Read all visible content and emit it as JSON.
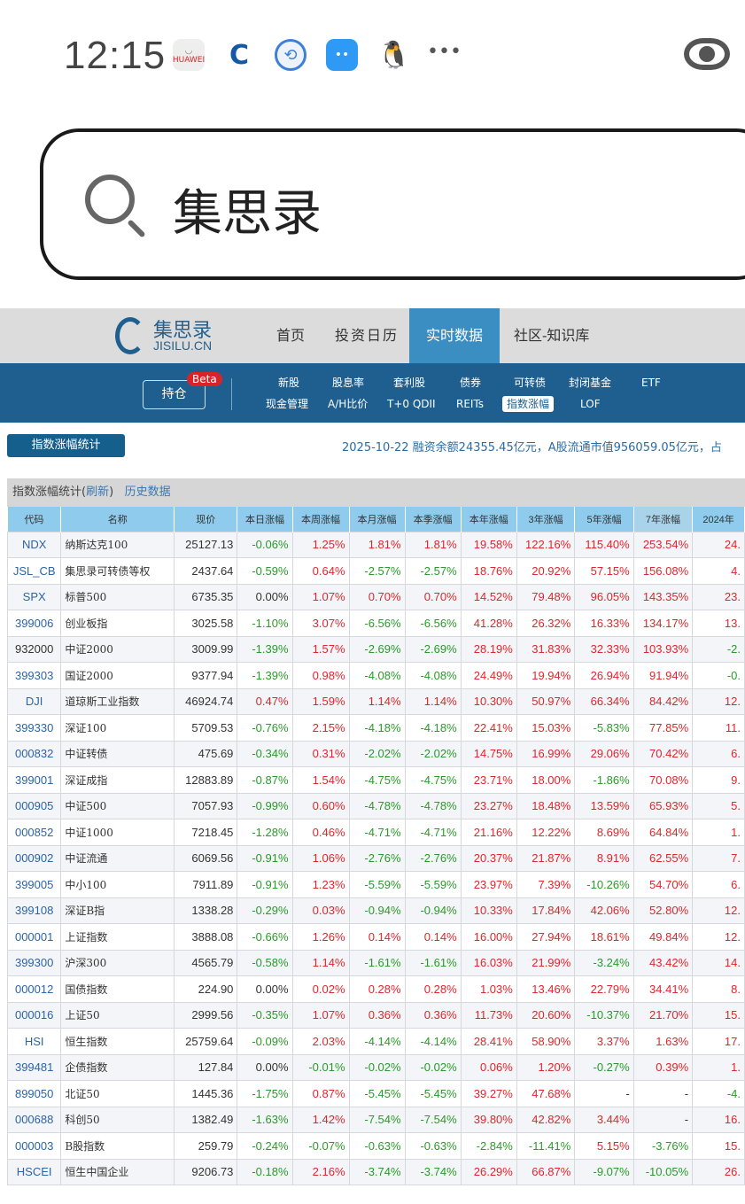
{
  "status": {
    "time": "12:15",
    "icons": [
      "huawei-appgallery-icon",
      "ccb-bank-icon",
      "app-icon",
      "message-icon",
      "qq-penguin-icon",
      "more-dots-icon",
      "eye-icon"
    ],
    "huawei": "HUAWEI",
    "more": "•••"
  },
  "search": {
    "query": "集思录"
  },
  "site": {
    "logo_cn": "集思录",
    "logo_en": "JISILU.CN",
    "nav": [
      "首页",
      "投资日历",
      "实时数据",
      "社区-知识库"
    ],
    "nav_active": 2,
    "hold": "持仓",
    "beta": "Beta",
    "sub_row1": [
      "新股",
      "股息率",
      "套利股",
      "债券",
      "可转债",
      "封闭基金",
      "ETF"
    ],
    "sub_row2": [
      "现金管理",
      "A/H比价",
      "T+0 QDII",
      "REITs",
      "指数涨幅",
      "LOF"
    ]
  },
  "page": {
    "button": "指数涨幅统计",
    "ticker": "2025-10-22 融资余额24355.45亿元，A股流通市值956059.05亿元，占",
    "title": "指数涨幅统计(",
    "refresh": "刷新",
    "title_end": ")",
    "history": "历史数据"
  },
  "colors": {
    "up": "#e0262b",
    "down": "#2a9a2a",
    "header": "#8ecbec",
    "band": "#1f5f8f"
  },
  "table": {
    "headers": [
      "代码",
      "名称",
      "现价",
      "本日涨幅",
      "本周涨幅",
      "本月涨幅",
      "本季涨幅",
      "本年涨幅",
      "3年涨幅",
      "5年涨幅",
      "7年涨幅",
      "2024年"
    ],
    "rows": [
      [
        "NDX",
        "纳斯达克100",
        "25127.13",
        "-0.06%",
        "1.25%",
        "1.81%",
        "1.81%",
        "19.58%",
        "122.16%",
        "115.40%",
        "253.54%",
        "24."
      ],
      [
        "JSL_CB",
        "集思录可转债等权",
        "2437.64",
        "-0.59%",
        "0.64%",
        "-2.57%",
        "-2.57%",
        "18.76%",
        "20.92%",
        "57.15%",
        "156.08%",
        "4."
      ],
      [
        "SPX",
        "标普500",
        "6735.35",
        "0.00%",
        "1.07%",
        "0.70%",
        "0.70%",
        "14.52%",
        "79.48%",
        "96.05%",
        "143.35%",
        "23."
      ],
      [
        "399006",
        "创业板指",
        "3025.58",
        "-1.10%",
        "3.07%",
        "-6.56%",
        "-6.56%",
        "41.28%",
        "26.32%",
        "16.33%",
        "134.17%",
        "13."
      ],
      [
        "932000",
        "中证2000",
        "3009.99",
        "-1.39%",
        "1.57%",
        "-2.69%",
        "-2.69%",
        "28.19%",
        "31.83%",
        "32.33%",
        "103.93%",
        "-2."
      ],
      [
        "399303",
        "国证2000",
        "9377.94",
        "-1.39%",
        "0.98%",
        "-4.08%",
        "-4.08%",
        "24.49%",
        "19.94%",
        "26.94%",
        "91.94%",
        "-0."
      ],
      [
        "DJI",
        "道琼斯工业指数",
        "46924.74",
        "0.47%",
        "1.59%",
        "1.14%",
        "1.14%",
        "10.30%",
        "50.97%",
        "66.34%",
        "84.42%",
        "12."
      ],
      [
        "399330",
        "深证100",
        "5709.53",
        "-0.76%",
        "2.15%",
        "-4.18%",
        "-4.18%",
        "22.41%",
        "15.03%",
        "-5.83%",
        "77.85%",
        "11."
      ],
      [
        "000832",
        "中证转债",
        "475.69",
        "-0.34%",
        "0.31%",
        "-2.02%",
        "-2.02%",
        "14.75%",
        "16.99%",
        "29.06%",
        "70.42%",
        "6."
      ],
      [
        "399001",
        "深证成指",
        "12883.89",
        "-0.87%",
        "1.54%",
        "-4.75%",
        "-4.75%",
        "23.71%",
        "18.00%",
        "-1.86%",
        "70.08%",
        "9."
      ],
      [
        "000905",
        "中证500",
        "7057.93",
        "-0.99%",
        "0.60%",
        "-4.78%",
        "-4.78%",
        "23.27%",
        "18.48%",
        "13.59%",
        "65.93%",
        "5."
      ],
      [
        "000852",
        "中证1000",
        "7218.45",
        "-1.28%",
        "0.46%",
        "-4.71%",
        "-4.71%",
        "21.16%",
        "12.22%",
        "8.69%",
        "64.84%",
        "1."
      ],
      [
        "000902",
        "中证流通",
        "6069.56",
        "-0.91%",
        "1.06%",
        "-2.76%",
        "-2.76%",
        "20.37%",
        "21.87%",
        "8.91%",
        "62.55%",
        "7."
      ],
      [
        "399005",
        "中小100",
        "7911.89",
        "-0.91%",
        "1.23%",
        "-5.59%",
        "-5.59%",
        "23.97%",
        "7.39%",
        "-10.26%",
        "54.70%",
        "6."
      ],
      [
        "399108",
        "深证B指",
        "1338.28",
        "-0.29%",
        "0.03%",
        "-0.94%",
        "-0.94%",
        "10.33%",
        "17.84%",
        "42.06%",
        "52.80%",
        "12."
      ],
      [
        "000001",
        "上证指数",
        "3888.08",
        "-0.66%",
        "1.26%",
        "0.14%",
        "0.14%",
        "16.00%",
        "27.94%",
        "18.61%",
        "49.84%",
        "12."
      ],
      [
        "399300",
        "沪深300",
        "4565.79",
        "-0.58%",
        "1.14%",
        "-1.61%",
        "-1.61%",
        "16.03%",
        "21.99%",
        "-3.24%",
        "43.42%",
        "14."
      ],
      [
        "000012",
        "国债指数",
        "224.90",
        "0.00%",
        "0.02%",
        "0.28%",
        "0.28%",
        "1.03%",
        "13.46%",
        "22.79%",
        "34.41%",
        "8."
      ],
      [
        "000016",
        "上证50",
        "2999.56",
        "-0.35%",
        "1.07%",
        "0.36%",
        "0.36%",
        "11.73%",
        "20.60%",
        "-10.37%",
        "21.70%",
        "15."
      ],
      [
        "HSI",
        "恒生指数",
        "25759.64",
        "-0.09%",
        "2.03%",
        "-4.14%",
        "-4.14%",
        "28.41%",
        "58.90%",
        "3.37%",
        "1.63%",
        "17."
      ],
      [
        "399481",
        "企债指数",
        "127.84",
        "0.00%",
        "-0.01%",
        "-0.02%",
        "-0.02%",
        "0.06%",
        "1.20%",
        "-0.27%",
        "0.39%",
        "1."
      ],
      [
        "899050",
        "北证50",
        "1445.36",
        "-1.75%",
        "0.87%",
        "-5.45%",
        "-5.45%",
        "39.27%",
        "47.68%",
        "-",
        "-",
        "-4."
      ],
      [
        "000688",
        "科创50",
        "1382.49",
        "-1.63%",
        "1.42%",
        "-7.54%",
        "-7.54%",
        "39.80%",
        "42.82%",
        "3.44%",
        "-",
        "16."
      ],
      [
        "000003",
        "B股指数",
        "259.79",
        "-0.24%",
        "-0.07%",
        "-0.63%",
        "-0.63%",
        "-2.84%",
        "-11.41%",
        "5.15%",
        "-3.76%",
        "15."
      ],
      [
        "HSCEI",
        "恒生中国企业",
        "9206.73",
        "-0.18%",
        "2.16%",
        "-3.74%",
        "-3.74%",
        "26.29%",
        "66.87%",
        "-9.07%",
        "-10.05%",
        "26."
      ]
    ],
    "plain_code_rows": [
      4
    ]
  }
}
